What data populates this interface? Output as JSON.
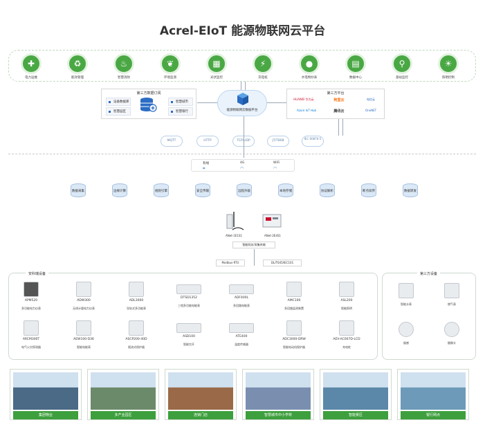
{
  "title": "Acrel-EIoT 能源物联网云平台",
  "apps": [
    {
      "label": "电力运维",
      "icon": "wrench-icon",
      "glyph": "✚"
    },
    {
      "label": "能效管理",
      "icon": "recycle-icon",
      "glyph": "♻"
    },
    {
      "label": "智慧消防",
      "icon": "fire-shield-icon",
      "glyph": "♨"
    },
    {
      "label": "环境监测",
      "icon": "leaf-icon",
      "glyph": "❦"
    },
    {
      "label": "光伏监控",
      "icon": "solar-panel-icon",
      "glyph": "▦"
    },
    {
      "label": "充电桩",
      "icon": "charging-pile-icon",
      "glyph": "⚡"
    },
    {
      "label": "水电物抄表",
      "icon": "water-drop-icon",
      "glyph": "●"
    },
    {
      "label": "数据中心",
      "icon": "server-icon",
      "glyph": "▤"
    },
    {
      "label": "基站监控",
      "icon": "antenna-icon",
      "glyph": "⚲"
    },
    {
      "label": "照明控制",
      "icon": "bulb-icon",
      "glyph": "☀"
    }
  ],
  "third_party_subscribe": {
    "title": "第三方数据订阅",
    "chips": [
      "设备数据库",
      "智慧园区",
      "智慧城市",
      "智慧银行"
    ]
  },
  "cloud_center": {
    "label": "能源物联网云数据平台"
  },
  "third_party_platform": {
    "title": "第三方平台",
    "items": [
      "HUAWEI 华为云",
      "阿里云",
      "电信云",
      "Azure IoT Hub",
      "腾讯云",
      "OneNET"
    ]
  },
  "protocols": [
    "MQTT",
    "HTTP",
    "TCP/UDP",
    "JT/T808",
    "IEC 60870-5"
  ],
  "networks": [
    "有线",
    "4G",
    "WiFi"
  ],
  "edge_services": [
    "数据采集",
    "边缘计算",
    "规则引擎",
    "安全传输",
    "远程升级",
    "本地存储",
    "协议解析",
    "断点续传",
    "数据转发"
  ],
  "gateways": [
    {
      "name": "ANet-1E1S1",
      "image": "4g-gateway"
    },
    {
      "name": "ANet-2E4S1",
      "image": "din-rail-gateway"
    }
  ],
  "gateway_caption": "智能网关/采集终端",
  "bus_labels": [
    "Modbus-RTU",
    "DL/T645/IEC101"
  ],
  "ankerui": {
    "title": "安科瑞设备",
    "devices": [
      {
        "name": "APM520",
        "desc": "多功能电力仪表"
      },
      {
        "name": "ADW300",
        "desc": "无线计量电力仪表"
      },
      {
        "name": "ADL3000",
        "desc": "导轨式多功能表"
      },
      {
        "name": "DTSD1352",
        "desc": "三相多功能电能表"
      },
      {
        "name": "ADF400L",
        "desc": "多回路电能表"
      },
      {
        "name": "AMC100",
        "desc": "多回路监测装置"
      },
      {
        "name": "ASL200",
        "desc": "智能照明"
      },
      {
        "name": "ARCM300T",
        "desc": "电气火灾探测器"
      },
      {
        "name": "AEW100-D36",
        "desc": "智能电能表"
      },
      {
        "name": "ASCP200-40D",
        "desc": "限流式保护器"
      },
      {
        "name": "ASD100",
        "desc": "智能空开"
      },
      {
        "name": "ATE400",
        "desc": "温度传感器"
      },
      {
        "name": "ADC3000-DRW",
        "desc": "智能电动机保护器"
      },
      {
        "name": "AEV-AC007D-LCD",
        "desc": "充电桩"
      }
    ]
  },
  "third_party_devices": {
    "title": "第三方设备",
    "devices": [
      {
        "desc": "智能水表"
      },
      {
        "desc": "燃气表"
      },
      {
        "desc": "烟感"
      },
      {
        "desc": "摄像头"
      }
    ]
  },
  "scenes": [
    {
      "label": "集团物业",
      "color": "#4a6a86"
    },
    {
      "label": "多产业园区",
      "color": "#6b8a6a"
    },
    {
      "label": "连锁门店",
      "color": "#9a6a48"
    },
    {
      "label": "智慧城市中小学校",
      "color": "#7a8fb0"
    },
    {
      "label": "智能景区",
      "color": "#5b88a8"
    },
    {
      "label": "银行网点",
      "color": "#6d9ab8"
    }
  ]
}
